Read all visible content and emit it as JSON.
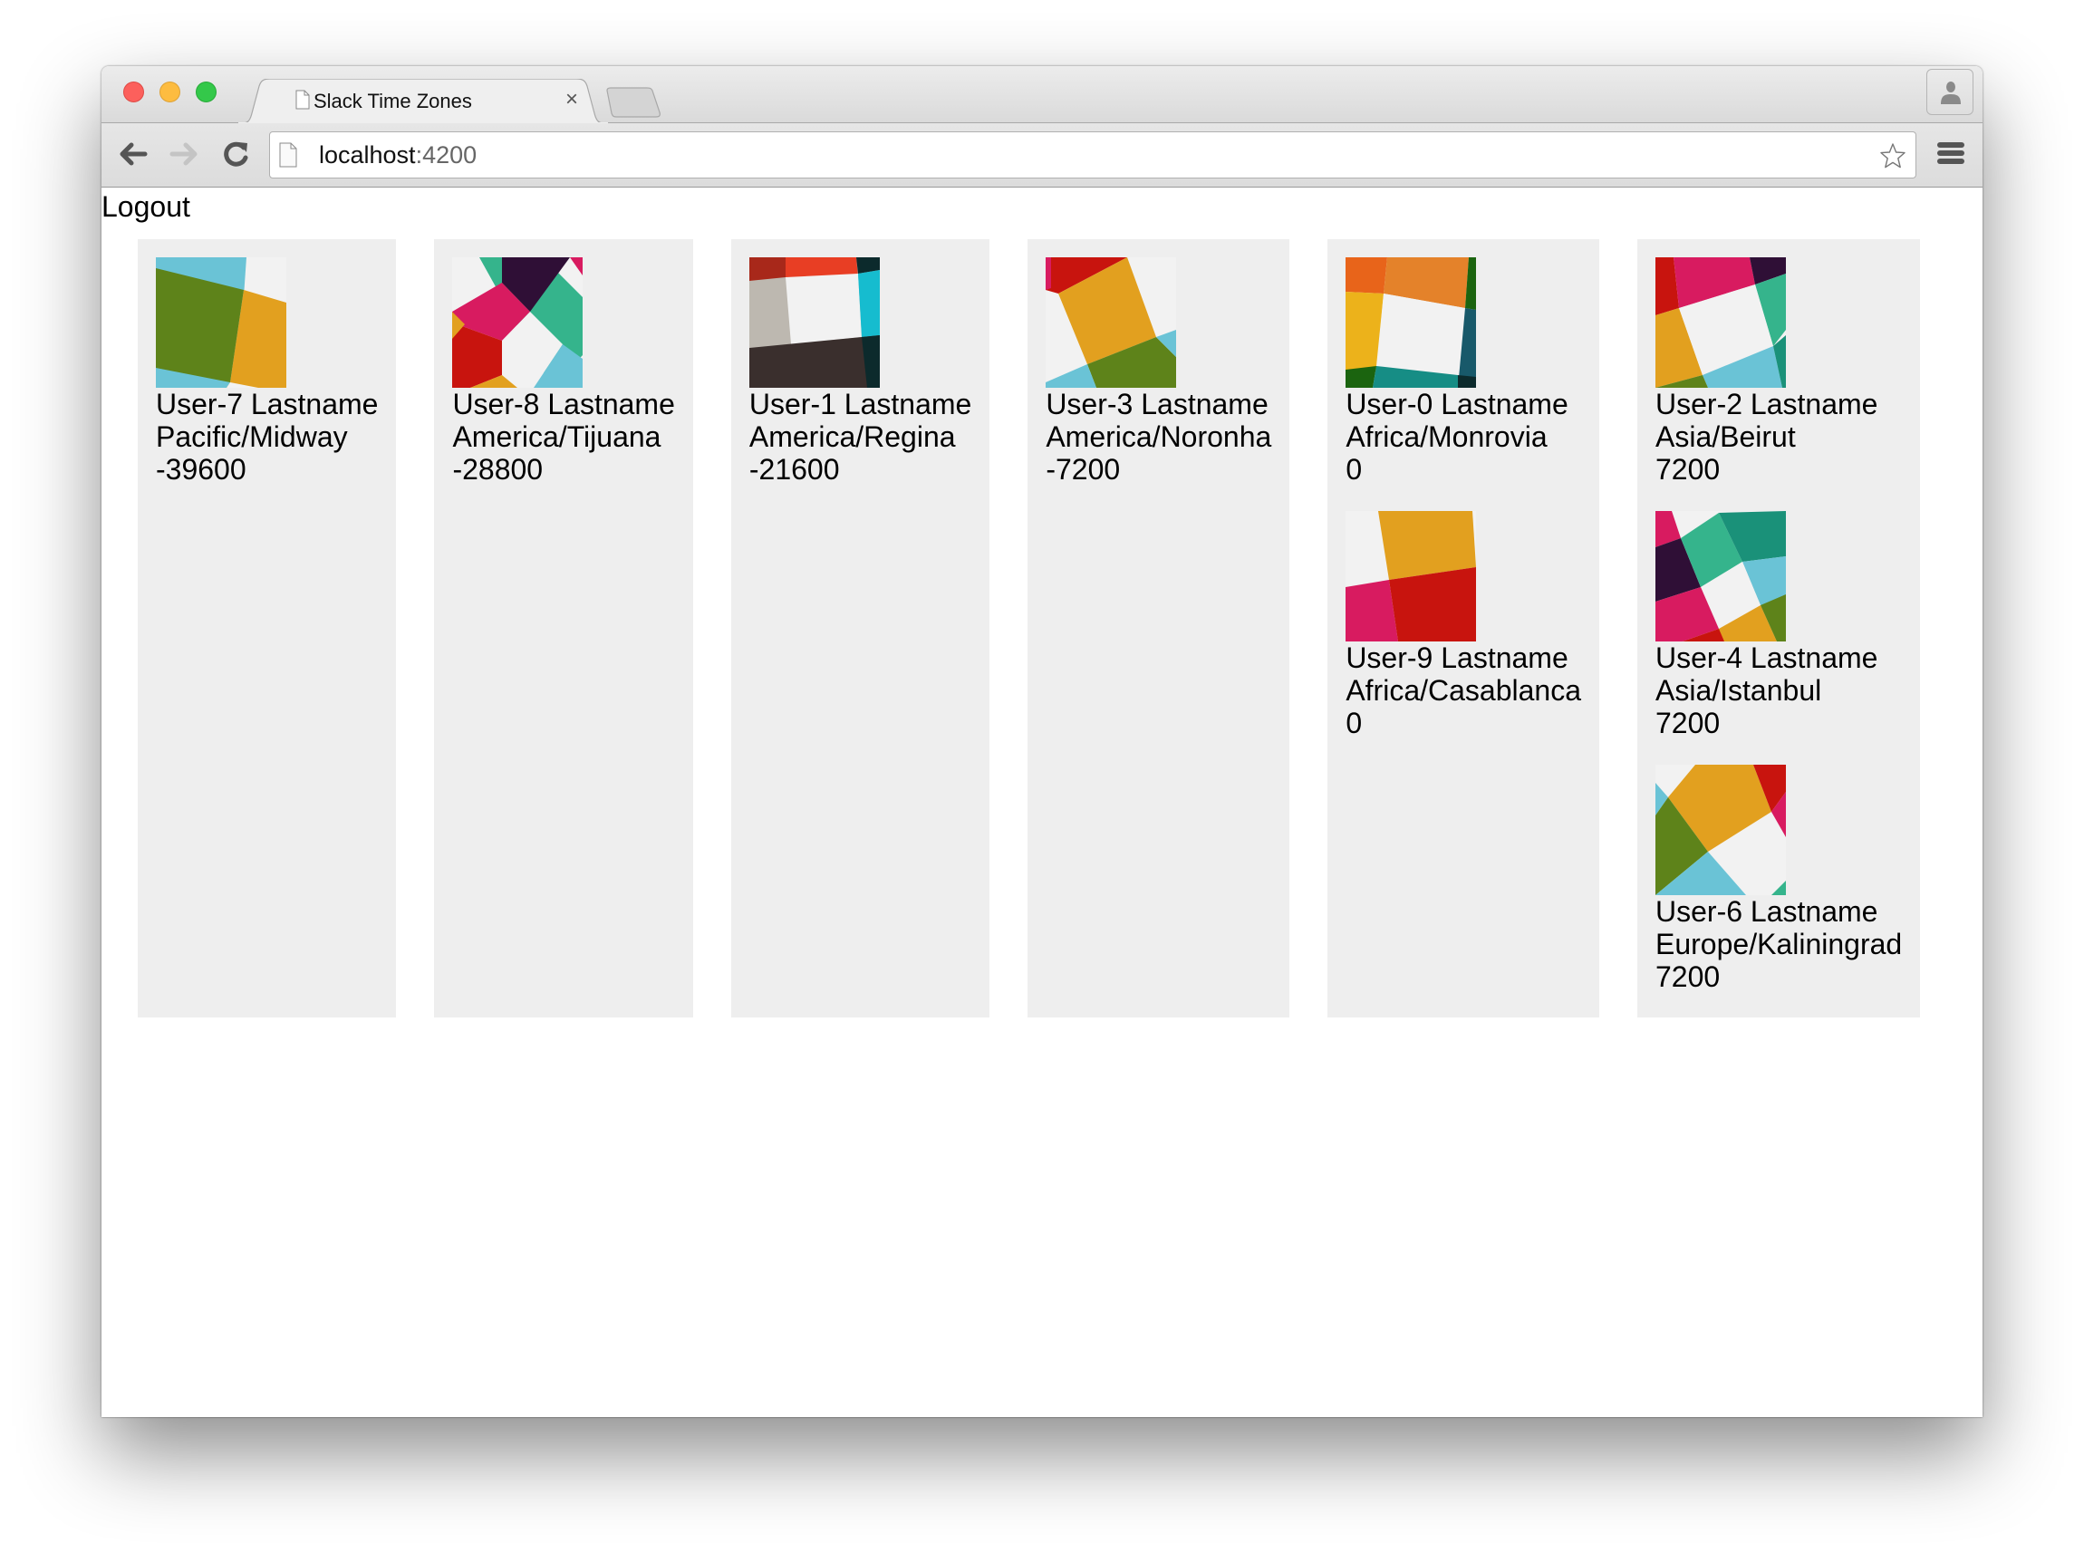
{
  "browser": {
    "tab_title": "Slack Time Zones",
    "tab_close_glyph": "×",
    "url_host": "localhost",
    "url_port": ":4200",
    "icons": {
      "back": "back-arrow-icon",
      "forward": "forward-arrow-icon",
      "reload": "reload-icon",
      "page": "page-icon",
      "star": "bookmark-star-icon",
      "menu": "hamburger-menu-icon",
      "profile": "person-icon"
    },
    "traffic_lights": {
      "close": "#fc605c",
      "minimize": "#fdbc40",
      "maximize": "#34c84a"
    }
  },
  "page": {
    "logout_label": "Logout",
    "card_background": "#eeeeee",
    "columns": [
      {
        "users": [
          {
            "name": "User-7 Lastname",
            "timezone": "Pacific/Midway",
            "offset": "-39600",
            "avatar": "user-7"
          }
        ]
      },
      {
        "users": [
          {
            "name": "User-8 Lastname",
            "timezone": "America/Tijuana",
            "offset": "-28800",
            "avatar": "user-8"
          }
        ]
      },
      {
        "users": [
          {
            "name": "User-1 Lastname",
            "timezone": "America/Regina",
            "offset": "-21600",
            "avatar": "user-1"
          }
        ]
      },
      {
        "users": [
          {
            "name": "User-3 Lastname",
            "timezone": "America/Noronha",
            "offset": "-7200",
            "avatar": "user-3"
          }
        ]
      },
      {
        "users": [
          {
            "name": "User-0 Lastname",
            "timezone": "Africa/Monrovia",
            "offset": "0",
            "avatar": "user-0"
          },
          {
            "name": "User-9 Lastname",
            "timezone": "Africa/Casablanca",
            "offset": "0",
            "avatar": "user-9"
          }
        ]
      },
      {
        "users": [
          {
            "name": "User-2 Lastname",
            "timezone": "Asia/Beirut",
            "offset": "7200",
            "avatar": "user-2"
          },
          {
            "name": "User-4 Lastname",
            "timezone": "Asia/Istanbul",
            "offset": "7200",
            "avatar": "user-4"
          },
          {
            "name": "User-6 Lastname",
            "timezone": "Europe/Kaliningrad",
            "offset": "7200",
            "avatar": "user-6"
          }
        ]
      }
    ]
  },
  "avatar_palette": {
    "blue": "#6ac3d6",
    "green": "#5e831a",
    "orange": "#e2a01f",
    "white": "#f2f2f2",
    "teal": "#35b48c",
    "plum": "#2f0f36",
    "pink": "#d81b60",
    "red": "#c8140e",
    "darkred": "#a8281a",
    "vermilion": "#e83e24",
    "stone": "#bdb8b0",
    "charcoal": "#3a2f2d",
    "cyan": "#16bccf",
    "darkteal": "#0c2a2c",
    "amber": "#e8641a",
    "tangerine": "#e4822a",
    "yellow": "#ecb21b",
    "forest": "#1b640f",
    "sea": "#168d85",
    "petrol": "#18596a",
    "jade": "#1a9179"
  }
}
